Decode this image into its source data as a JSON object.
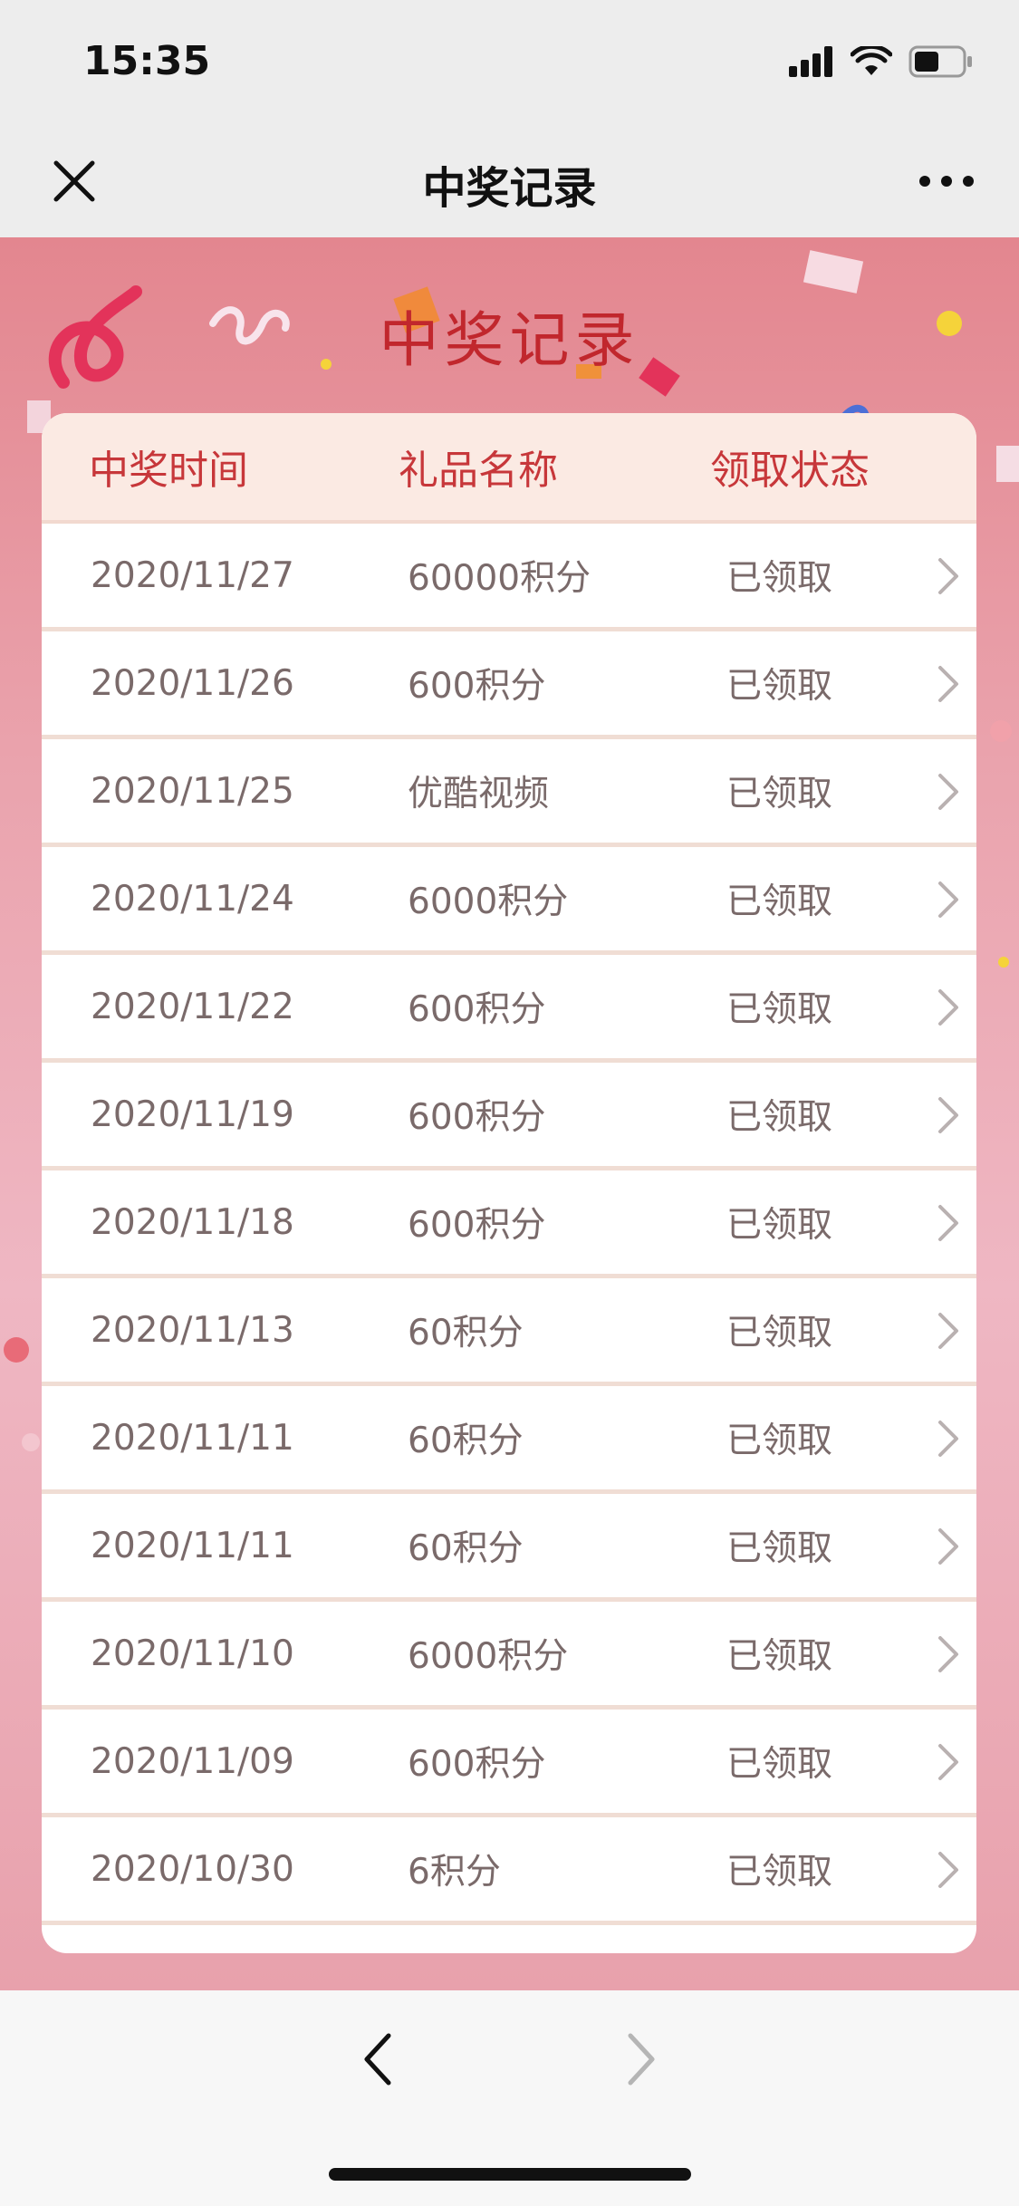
{
  "status_bar": {
    "time": "15:35"
  },
  "nav": {
    "title": "中奖记录"
  },
  "banner": {
    "title": "中奖记录"
  },
  "table": {
    "headers": [
      "中奖时间",
      "礼品名称",
      "领取状态"
    ],
    "rows": [
      {
        "date": "2020/11/27",
        "prize": "60000积分",
        "status": "已领取"
      },
      {
        "date": "2020/11/26",
        "prize": "600积分",
        "status": "已领取"
      },
      {
        "date": "2020/11/25",
        "prize": "优酷视频",
        "status": "已领取"
      },
      {
        "date": "2020/11/24",
        "prize": "6000积分",
        "status": "已领取"
      },
      {
        "date": "2020/11/22",
        "prize": "600积分",
        "status": "已领取"
      },
      {
        "date": "2020/11/19",
        "prize": "600积分",
        "status": "已领取"
      },
      {
        "date": "2020/11/18",
        "prize": "600积分",
        "status": "已领取"
      },
      {
        "date": "2020/11/13",
        "prize": "60积分",
        "status": "已领取"
      },
      {
        "date": "2020/11/11",
        "prize": "60积分",
        "status": "已领取"
      },
      {
        "date": "2020/11/11",
        "prize": "60积分",
        "status": "已领取"
      },
      {
        "date": "2020/11/10",
        "prize": "6000积分",
        "status": "已领取"
      },
      {
        "date": "2020/11/09",
        "prize": "600积分",
        "status": "已领取"
      },
      {
        "date": "2020/10/30",
        "prize": "6积分",
        "status": "已领取"
      }
    ]
  },
  "colors": {
    "accent_red": "#c7373a",
    "header_bg": "#fbeae3",
    "pink_bg": "#e3868f"
  },
  "icons": {
    "close": "close-icon",
    "more": "more-icon",
    "row_arrow": "chevron-right-icon",
    "back": "back-icon",
    "forward": "forward-icon"
  }
}
